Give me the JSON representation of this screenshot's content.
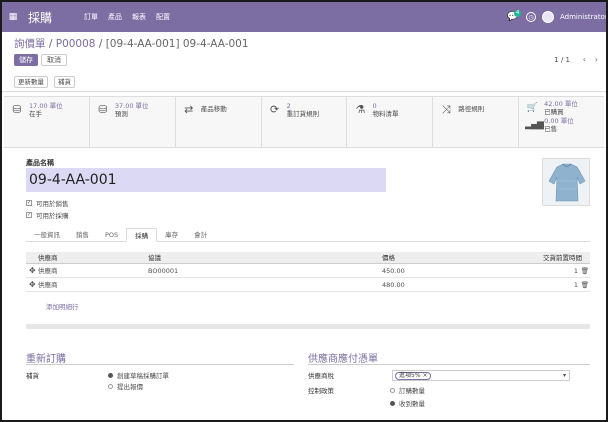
{
  "navbar": {
    "app_name": "採購",
    "menu": [
      "訂單",
      "產品",
      "報表",
      "配置"
    ],
    "chat_count": "4",
    "user": "Administrator"
  },
  "breadcrumb": {
    "part1": "詢價單",
    "part2": "P00008",
    "current": "[09-4-AA-001] 09-4-AA-001",
    "sep": "/"
  },
  "buttons": {
    "save": "儲存",
    "discard": "取消",
    "update_qty": "更新數量",
    "replenish": "補貨"
  },
  "pager": {
    "value": "1 / 1",
    "prev": "‹",
    "next": "›"
  },
  "stats": [
    {
      "icon": "cubes-icon",
      "glyph": "⛁",
      "value": "17.00 單位",
      "label": "在手"
    },
    {
      "icon": "cubes-forecast-icon",
      "glyph": "⛁",
      "value": "37.00 單位",
      "label": "預測"
    },
    {
      "icon": "exchange-icon",
      "glyph": "⇄",
      "value": "",
      "label": "產品移動"
    },
    {
      "icon": "refresh-icon",
      "glyph": "⟳",
      "value": "2",
      "label": "重訂貨規則"
    },
    {
      "icon": "flask-icon",
      "glyph": "⚗",
      "value": "0",
      "label": "物料清單"
    },
    {
      "icon": "random-icon",
      "glyph": "⤨",
      "value": "",
      "label": "路徑規則"
    },
    {
      "icon": "cart-icon",
      "glyph": "🛒",
      "value": "42.00 單位",
      "label": "已購買",
      "value2": "0.00 單位",
      "label2": "已售"
    }
  ],
  "product": {
    "name_label": "產品名稱",
    "name": "09-4-AA-001",
    "can_be_sold": "可用於銷售",
    "can_be_purchased": "可用於採購",
    "check_glyph": "✓"
  },
  "tabs": [
    "一般資訊",
    "銷售",
    "POS",
    "採購",
    "庫存",
    "會計"
  ],
  "vendor_table": {
    "headers": [
      "供應商",
      "協議",
      "價格",
      "交貨前置時間"
    ],
    "rows": [
      {
        "vendor": "供應商",
        "agreement": "BO00001",
        "price": "450.00",
        "lead": "1"
      },
      {
        "vendor": "供應商",
        "agreement": "",
        "price": "480.00",
        "lead": "1"
      }
    ],
    "add_line": "添加明細行",
    "delete_glyph": "🗑",
    "handle_glyph": "✥"
  },
  "reorder": {
    "title": "重新訂購",
    "field": "補貨",
    "options": [
      "創建草稿採購訂單",
      "提出報價"
    ],
    "selected": 0
  },
  "vendor_bills": {
    "title": "供應商應付憑單",
    "tax_label": "供應商稅",
    "tax_tag": "進項5%",
    "tag_remove": "×",
    "dropdown_glyph": "▾",
    "control_label": "控制政策",
    "options": [
      "訂購數量",
      "收到數量"
    ],
    "selected": 1
  }
}
